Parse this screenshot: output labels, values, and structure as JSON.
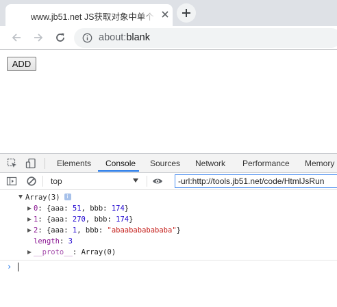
{
  "tab": {
    "title": "www.jb51.net JS获取对象中单个"
  },
  "toolbar": {
    "url_scheme": "about:",
    "url_path": "blank"
  },
  "page": {
    "add_button": "ADD"
  },
  "devtools": {
    "tabs": [
      "Elements",
      "Console",
      "Sources",
      "Network",
      "Performance",
      "Memory"
    ],
    "active_tab": "Console",
    "accent_color": "#1a73e8"
  },
  "console_toolbar": {
    "context": "top",
    "filter_value": "-url:http://tools.jb51.net/code/HtmlJsRun"
  },
  "console": {
    "array_header": "Array(3)",
    "items": [
      {
        "index": "0",
        "aaa": "51",
        "bbb": "174"
      },
      {
        "index": "1",
        "aaa": "270",
        "bbb": "174"
      },
      {
        "index": "2",
        "aaa": "1",
        "bbb": "\"abaabababababa\""
      }
    ],
    "length_key": "length",
    "length_value": "3",
    "proto_key": "__proto__",
    "proto_value": "Array(0)",
    "prompt": "›"
  },
  "icons": {
    "tab_close": "close-icon",
    "new_tab": "plus-icon",
    "back": "arrow-back-icon",
    "forward": "arrow-forward-icon",
    "reload": "reload-icon",
    "site_info": "info-icon",
    "inspect": "inspect-element-icon",
    "device": "device-toolbar-icon",
    "sidebar": "sidebar-toggle-icon",
    "clear": "clear-console-icon",
    "eye": "eye-icon"
  }
}
